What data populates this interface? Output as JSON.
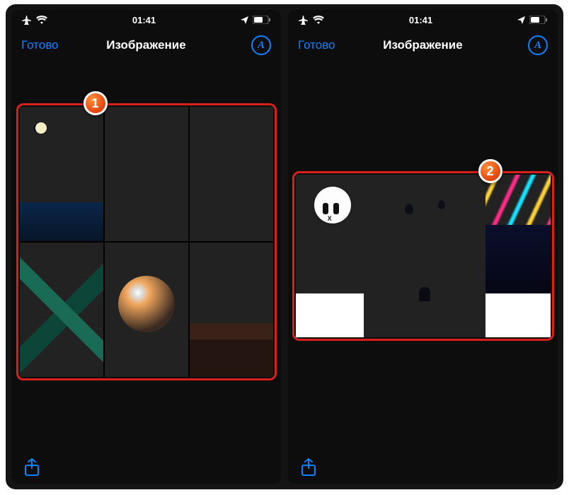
{
  "status": {
    "time": "01:41"
  },
  "nav": {
    "done": "Готово",
    "title": "Изображение",
    "markup_glyph": "A"
  },
  "callouts": {
    "one": "1",
    "two": "2"
  },
  "colors": {
    "accent": "#0a84ff",
    "highlight": "#d9201d"
  }
}
